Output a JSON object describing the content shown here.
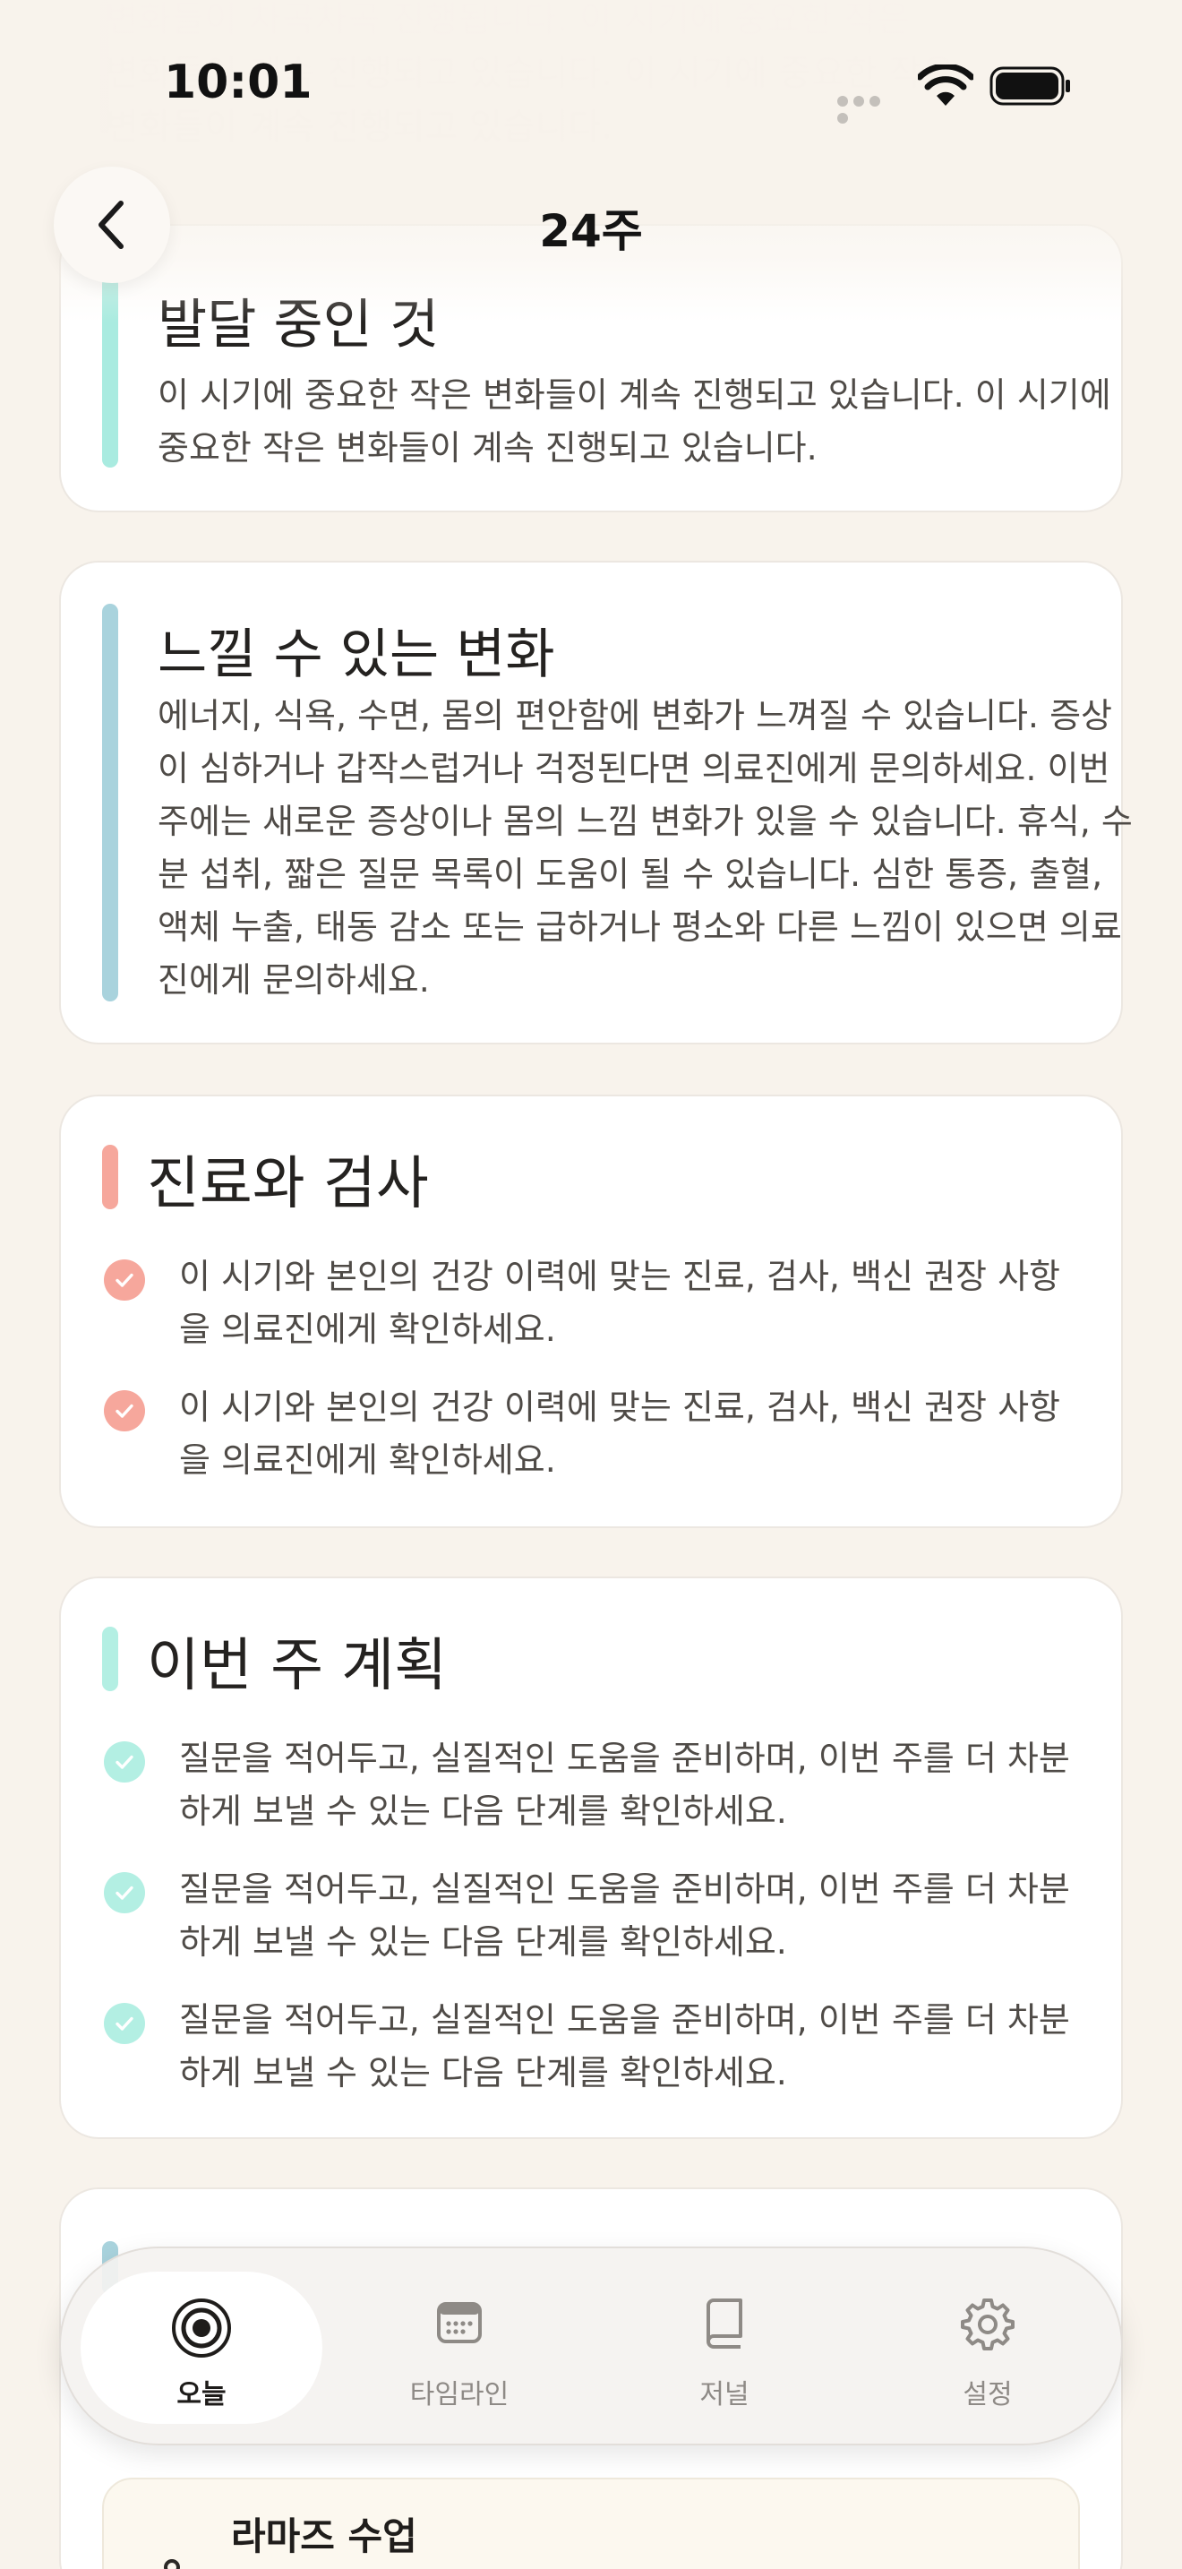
{
  "status_bar": {
    "time": "10:01"
  },
  "nav": {
    "title": "24주",
    "back_icon": "chevron-left-icon"
  },
  "ghost_text": [
    "변화들이 차곡차곡 진행됩니다. 이 시기에 중요한 작은",
    "변화들이 계속 진행되고 있습니다. 이 시기에 중요한 작은",
    "변화들이 계속 진행되고 있습니다."
  ],
  "sections": {
    "developing": {
      "title": "발달 중인 것",
      "body": "이 시기에 중요한 작은 변화들이 계속 진행되고 있습니다. 이 시기에 중요한 작은 변화들이 계속 진행되고 있습니다.",
      "accent": "#a9ebe0"
    },
    "changes": {
      "title": "느낄 수 있는 변화",
      "body": "에너지, 식욕, 수면, 몸의 편안함에 변화가 느껴질 수 있습니다. 증상이 심하거나 갑작스럽거나 걱정된다면 의료진에게 문의하세요. 이번 주에는 새로운 증상이나 몸의 느낌 변화가 있을 수 있습니다. 휴식, 수분 섭취, 짧은 질문 목록이 도움이 될 수 있습니다. 심한 통증, 출혈, 액체 누출, 태동 감소 또는 급하거나 평소와 다른 느낌이 있으면 의료진에게 문의하세요.",
      "accent": "#a9d3dd"
    },
    "care": {
      "title": "진료와 검사",
      "accent": "#f6a79c",
      "items": [
        "이 시기와 본인의 건강 이력에 맞는 진료, 검사, 백신 권장 사항을 의료진에게 확인하세요.",
        "이 시기와 본인의 건강 이력에 맞는 진료, 검사, 백신 권장 사항을 의료진에게 확인하세요."
      ]
    },
    "plan": {
      "title": "이번 주 계획",
      "accent": "#b3efe3",
      "items": [
        "질문을 적어두고, 실질적인 도움을 준비하며, 이번 주를 더 차분하게 보낼 수 있는 다음 단계를 확인하세요.",
        "질문을 적어두고, 실질적인 도움을 준비하며, 이번 주를 더 차분하게 보낼 수 있는 다음 단계를 확인하세요.",
        "질문을 적어두고, 실질적인 도움을 준비하며, 이번 주를 더 차분하게 보낼 수 있는 다음 단계를 확인하세요."
      ]
    },
    "bottom_card": {
      "title": "라마즈 수업"
    }
  },
  "tabbar": {
    "tabs": [
      {
        "label": "오늘",
        "icon": "target-icon",
        "active": true
      },
      {
        "label": "타임라인",
        "icon": "calendar-icon",
        "active": false
      },
      {
        "label": "저널",
        "icon": "book-icon",
        "active": false
      },
      {
        "label": "설정",
        "icon": "gear-icon",
        "active": false
      }
    ]
  },
  "colors": {
    "background": "#f8f3ec",
    "check_coral": "#f6a79c",
    "check_mint": "#b3efe3"
  }
}
